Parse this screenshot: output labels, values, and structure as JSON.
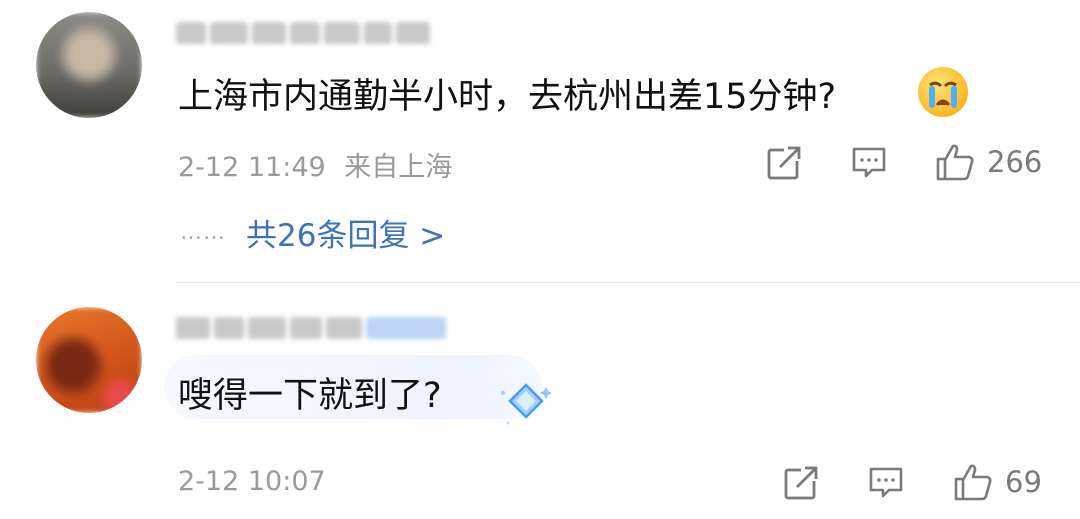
{
  "comments": [
    {
      "text": "上海市内通勤半小时，去杭州出差15分钟?",
      "date": "2-12 11:49",
      "location": "来自上海",
      "likes": "266",
      "replies": "共26条回复 >",
      "reply_dots": "……",
      "emoji": "crying-face-emoji"
    },
    {
      "text": "嗖得一下就到了?",
      "date": "2-12 10:07",
      "likes": "69"
    }
  ],
  "icons": {
    "share": "share-icon",
    "comment": "comment-icon",
    "like": "thumbs-up-icon"
  },
  "colors": {
    "link": "#3f73b8",
    "meta": "#9a9a9a",
    "bubble": "#edf3ff"
  }
}
